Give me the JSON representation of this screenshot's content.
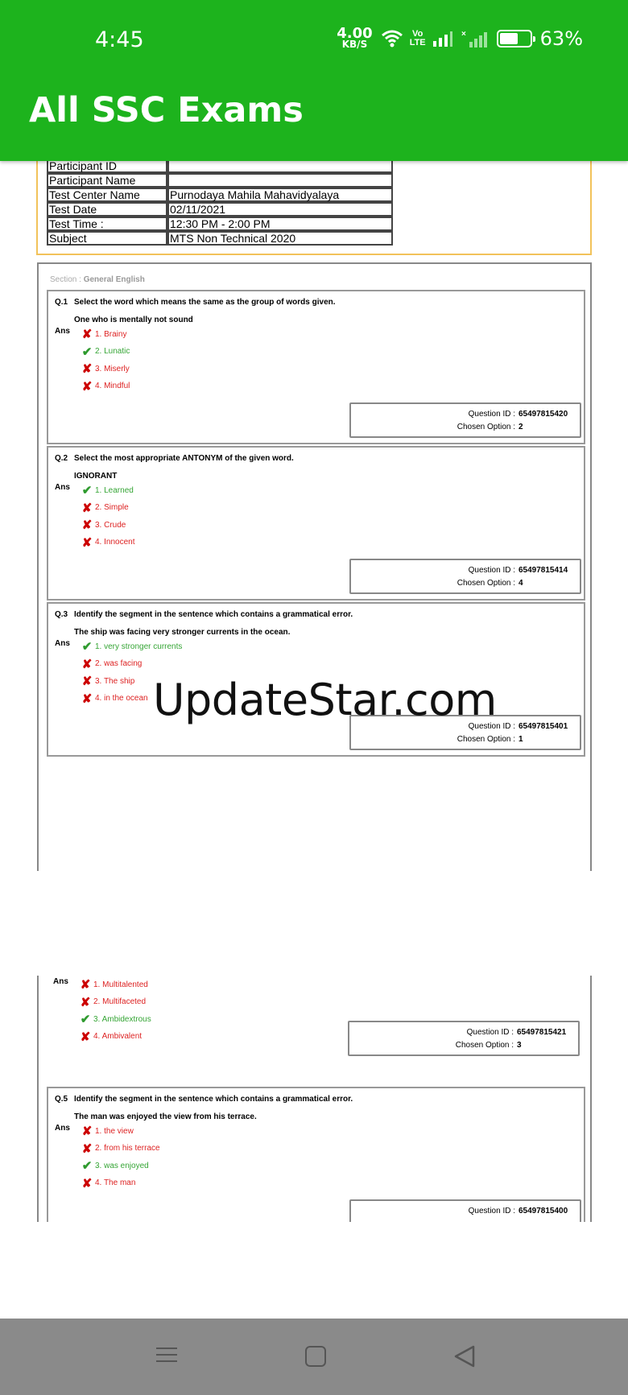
{
  "status_bar": {
    "time": "4:45",
    "net_speed": "4.00",
    "net_unit": "KB/S",
    "volte_top": "Vo",
    "volte_bottom": "LTE",
    "battery": "63%",
    "battery_level": 0.63,
    "signal2_mark": "×"
  },
  "app": {
    "title": "All SSC Exams"
  },
  "candidate": {
    "rows": [
      {
        "label": "Participant ID",
        "value": ""
      },
      {
        "label": "Participant Name",
        "value": ""
      },
      {
        "label": "Test Center Name",
        "value": "Purnodaya Mahila Mahavidyalaya"
      },
      {
        "label": "Test Date",
        "value": "02/11/2021"
      },
      {
        "label": "Test Time :",
        "value": "12:30 PM - 2:00 PM"
      },
      {
        "label": "Subject",
        "value": "MTS Non Technical 2020"
      }
    ]
  },
  "section": {
    "prefix": "Section : ",
    "name": "General English"
  },
  "qinfo_labels": {
    "id": "Question ID : ",
    "chosen": "Chosen Option : "
  },
  "ans_label": "Ans",
  "questions": [
    {
      "num": "Q.1",
      "text": "Select the word which means the same as the group of words given.",
      "sub": "One who is mentally not sound",
      "options": [
        "1. Brainy",
        "2. Lunatic",
        "3. Miserly",
        "4. Mindful"
      ],
      "correct": 2,
      "question_id": "65497815420",
      "chosen": "2"
    },
    {
      "num": "Q.2",
      "text": "Select the most appropriate ANTONYM of the given word.",
      "sub": "IGNORANT",
      "options": [
        "1. Learned",
        "2. Simple",
        "3. Crude",
        "4. Innocent"
      ],
      "correct": 1,
      "question_id": "65497815414",
      "chosen": "4"
    },
    {
      "num": "Q.3",
      "text": "Identify the segment in the sentence which contains a grammatical error.",
      "sub": "The ship was facing very stronger currents in the ocean.",
      "options": [
        "1. very stronger currents",
        "2. was facing",
        "3. The ship",
        "4. in the ocean"
      ],
      "correct": 1,
      "question_id": "65497815401",
      "chosen": "1"
    },
    {
      "num": "",
      "text": "",
      "sub": "",
      "options": [
        "1. Multitalented",
        "2. Multifaceted",
        "3. Ambidextrous",
        "4. Ambivalent"
      ],
      "correct": 3,
      "question_id": "65497815421",
      "chosen": "3"
    },
    {
      "num": "Q.5",
      "text": "Identify the segment in the sentence which contains a grammatical error.",
      "sub": "The man was enjoyed the view from his terrace.",
      "options": [
        "1. the view",
        "2. from his terrace",
        "3. was enjoyed",
        "4. The man"
      ],
      "correct": 3,
      "question_id": "65497815400",
      "chosen": ""
    }
  ],
  "watermark": "UpdateStar.com",
  "icons": {
    "correct": "check-icon",
    "wrong": "cross-icon"
  },
  "colors": {
    "appbar": "#1db31d",
    "correct": "#35a535",
    "wrong": "#d22222",
    "info_border": "#f2c25a"
  }
}
